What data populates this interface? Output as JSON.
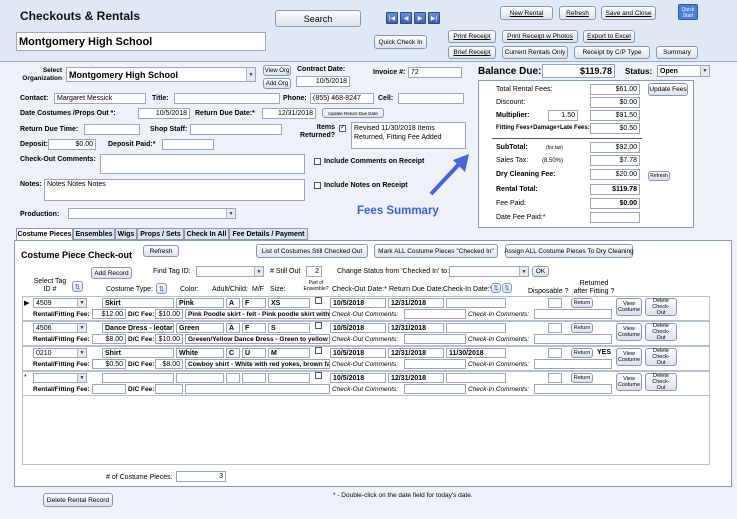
{
  "header": {
    "title": "Checkouts & Rentals",
    "school": "Montgomery High School",
    "search_label": "Search",
    "quick_check_in": "Quick Check In",
    "new_rental": "New Rental",
    "refresh": "Refresh",
    "save_close": "Save and Close",
    "quick_start": "Quick Start",
    "print_receipt": "Print Receipt",
    "print_receipt_photos": "Print Receipt w Photos",
    "export_excel": "Export to Excel",
    "brief_receipt": "Brief Receipt",
    "current_rentals_only": "Current Rentals Only",
    "receipt_by_cp": "Receipt by C/P Type",
    "summary": "Summary"
  },
  "form": {
    "select_org_label": "Select Organization",
    "org_value": "Montgomery High School",
    "view_org": "View Org",
    "add_org": "Add Org",
    "contract_date_label": "Contract Date:",
    "contract_date": "10/5/2018",
    "invoice_label": "Invoice #:",
    "invoice": "72",
    "contact_label": "Contact:",
    "contact": "Margaret Messick",
    "title_label": "Title:",
    "title": "",
    "phone_label": "Phone:",
    "phone": "(855) 468-8247",
    "cell_label": "Cell:",
    "cell": "",
    "date_out_label": "Date Costumes /Props Out *:",
    "date_out": "10/5/2018",
    "return_due_label": "Return Due Date:*",
    "return_due": "12/31/2018",
    "update_return": "Update Return Due Date",
    "return_time_label": "Return Due Time:",
    "return_time": "",
    "shop_staff_label": "Shop Staff:",
    "shop_staff": "",
    "items_returned_label": "Items Returned?",
    "items_returned_note": "Revised 11/30/2018 Items Returned, Fitting Fee Added",
    "deposit_label": "Deposit:",
    "deposit": "$0.00",
    "deposit_paid_label": "Deposit Paid:*",
    "deposit_paid": "",
    "checkout_comments_label": "Check-Out Comments:",
    "include_comments": "Include Comments on Receipt",
    "notes_label": "Notes:",
    "notes": "Notes Notes Notes",
    "include_notes": "Include Notes on Receipt",
    "production_label": "Production:"
  },
  "balance": {
    "due_label": "Balance Due:",
    "due": "$119.78",
    "status_label": "Status:",
    "status": "Open",
    "total_rental_label": "Total Rental Fees:",
    "total_rental": "$61.00",
    "update_fees": "Update Fees",
    "discount_label": "Discount:",
    "discount": "$0.00",
    "multiplier_label": "Multiplier:",
    "multiplier": "1.50",
    "multiplier_total": "$91.50",
    "fitting_label": "Fitting Fees+Damage+Late Fees:",
    "fitting": "$0.50",
    "subtotal_label": "SubTotal:",
    "for_tax": "(for tax)",
    "subtotal": "$92.00",
    "sales_tax_label": "Sales Tax:",
    "tax_rate": "(8.50%)",
    "sales_tax": "$7.78",
    "dry_clean_label": "Dry Cleaning Fee:",
    "dry_clean": "$20.00",
    "refresh": "Refresh",
    "rental_total_label": "Rental Total:",
    "rental_total": "$119.78",
    "fee_paid_label": "Fee Paid:",
    "fee_paid": "$0.00",
    "date_fee_paid_label": "Date Fee Paid:*",
    "date_fee_paid": ""
  },
  "annotation": "Fees Summary",
  "tabs": [
    "Costume Pieces",
    "Ensembles",
    "Wigs",
    "Props / Sets",
    "Check In All",
    "Fee Details / Payment"
  ],
  "pieces": {
    "title": "Costume Piece Check-out",
    "refresh": "Refresh",
    "list_checked_out": "List of Costumes Still Checked Out",
    "mark_all": "Mark ALL Costume Pieces \"Checked In\"",
    "assign_dry": "Assign ALL Costume Pieces To Dry Cleaning",
    "select_tag_label": "Select Tag ID #",
    "add_record": "Add Record",
    "find_tag_label": "Find Tag ID:",
    "still_out_label": "# Still Out",
    "still_out": "2",
    "change_status_label": "Change Status from 'Checked In' to:",
    "ok": "OK",
    "col_costume_type": "Costume Type:",
    "col_color": "Color:",
    "col_adult_child": "Adult/Child:",
    "col_mf": "M/F",
    "col_size": "Size:",
    "col_part_ens": "Part of Ensemble?",
    "col_checkout": "Check-Out Date:*",
    "col_return_due": "Return Due Date:",
    "col_checkin": "Check-In Date:*",
    "col_disposable": "Disposable ?",
    "col_returned_fitting": "Returned after Fitting ?",
    "rental_fee_label": "Rental/Fitting Fee:",
    "dc_fee_label": "D/C Fee:",
    "co_comments_label": "Check-Out Comments:",
    "ci_comments_label": "Check-In Comments:",
    "return_btn": "Return",
    "view_btn": "View Costume",
    "delete_btn": "Delete Check-Out",
    "rows": [
      {
        "tag": "4509",
        "type": "Skirt",
        "color": "Pink",
        "ac": "A",
        "mf": "F",
        "size": "XS",
        "out": "10/5/2018",
        "due": "12/31/2018",
        "in": "",
        "fee": "$12.00",
        "dc": "$10.00",
        "desc": "Pink Poodle skirt - felt - Pink poodle skirt with",
        "returned": ""
      },
      {
        "tag": "4506",
        "type": "Dance Dress - leotard c",
        "color": "Green",
        "ac": "A",
        "mf": "F",
        "size": "S",
        "out": "10/5/2018",
        "due": "12/31/2018",
        "in": "",
        "fee": "$8.00",
        "dc": "$10.00",
        "desc": "Greeen/Yellow Dance Dress - Green to yellow",
        "returned": ""
      },
      {
        "tag": "0210",
        "type": "Shirt",
        "color": "White",
        "ac": "C",
        "mf": "U",
        "size": "M",
        "out": "10/5/2018",
        "due": "12/31/2018",
        "in": "11/30/2018",
        "fee": "$0.50",
        "dc": "$8.00",
        "desc": "Cowboy shirt - White with red yokes, brown fa",
        "returned": "YES"
      },
      {
        "tag": "",
        "type": "",
        "color": "",
        "ac": "",
        "mf": "",
        "size": "",
        "out": "10/5/2018",
        "due": "12/31/2018",
        "in": "",
        "fee": "",
        "dc": "",
        "desc": "",
        "returned": ""
      }
    ],
    "count_label": "# of Costume Pieces:",
    "count": "3"
  },
  "footer": {
    "delete_rental": "Delete Rental Record",
    "note": "* - Double-click on the date field for today's date."
  }
}
